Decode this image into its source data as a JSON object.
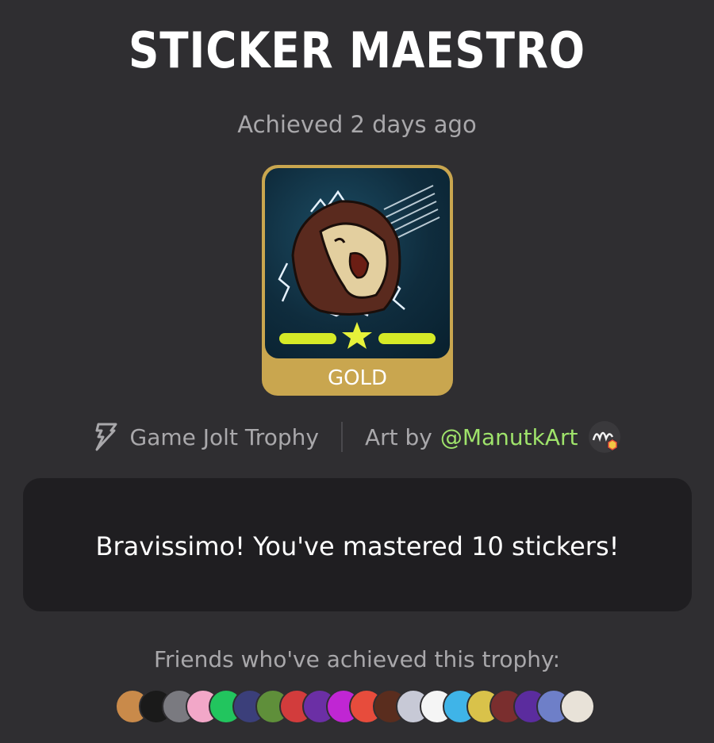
{
  "trophy": {
    "title": "STICKER MAESTRO",
    "achieved": "Achieved 2 days ago",
    "tier": "GOLD",
    "tier_color": "#c9a64f",
    "description": "Bravissimo! You've mastered 10 stickers!"
  },
  "meta": {
    "source_icon": "game-jolt-bolt-icon",
    "source_label": "Game Jolt Trophy",
    "art_by_label": "Art by",
    "artist_handle": "@ManutkArt",
    "handle_color": "#9fe36b"
  },
  "friends": {
    "label": "Friends who've achieved this trophy:",
    "avatars": [
      {
        "color": "#c98a4a"
      },
      {
        "color": "#1a1a1a"
      },
      {
        "color": "#7a7a80"
      },
      {
        "color": "#f2a7c8"
      },
      {
        "color": "#22c55e"
      },
      {
        "color": "#3b3f7a"
      },
      {
        "color": "#5f8f3a"
      },
      {
        "color": "#d23c3c"
      },
      {
        "color": "#6b2fa5"
      },
      {
        "color": "#c026d3"
      },
      {
        "color": "#e74c3c"
      },
      {
        "color": "#5a2d1e"
      },
      {
        "color": "#c7c9d6"
      },
      {
        "color": "#f5f5f5"
      },
      {
        "color": "#3fb4e8"
      },
      {
        "color": "#d9c24a"
      },
      {
        "color": "#7a2e2e"
      },
      {
        "color": "#5b2c9e"
      },
      {
        "color": "#6e7fc8"
      },
      {
        "color": "#e8e2d8"
      }
    ]
  }
}
